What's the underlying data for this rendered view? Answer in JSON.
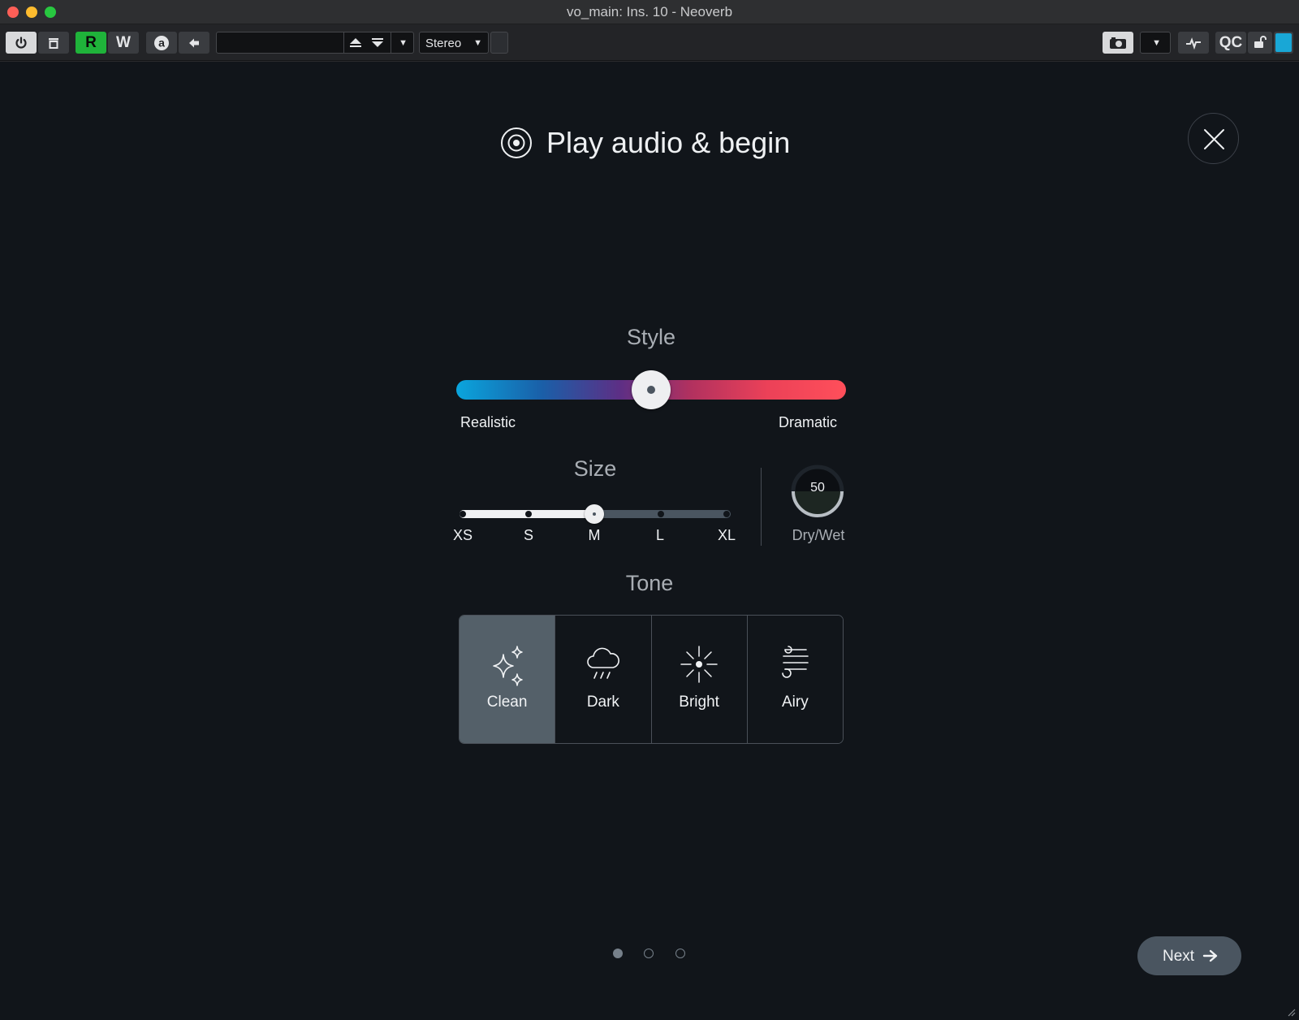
{
  "window": {
    "title": "vo_main: Ins. 10 - Neoverb"
  },
  "toolbar": {
    "power_icon": "power-icon",
    "bypass_icon": "bypass-icon",
    "read_label": "R",
    "write_label": "W",
    "automation_icon": "automation-a-icon",
    "back_icon": "arrow-left-icon",
    "preset_value": "",
    "prev_icon": "arrow-up-icon",
    "next_icon": "arrow-down-icon",
    "channel_value": "Stereo",
    "snapshot_icon": "camera-icon",
    "activity_icon": "pulse-icon",
    "qc_label": "QC",
    "lock_icon": "unlock-icon",
    "accent_color": "#19a7d6"
  },
  "assistant": {
    "heading": "Play audio & begin",
    "heading_icon": "record-target-icon",
    "close_icon": "close-icon",
    "style": {
      "label": "Style",
      "left_label": "Realistic",
      "right_label": "Dramatic",
      "value": 0.5
    },
    "size": {
      "label": "Size",
      "options": [
        "XS",
        "S",
        "M",
        "L",
        "XL"
      ],
      "selected": "M"
    },
    "dry_wet": {
      "label": "Dry/Wet",
      "value": "50"
    },
    "tone": {
      "label": "Tone",
      "options": [
        {
          "label": "Clean",
          "icon": "sparkles-icon"
        },
        {
          "label": "Dark",
          "icon": "rain-cloud-icon"
        },
        {
          "label": "Bright",
          "icon": "sun-burst-icon"
        },
        {
          "label": "Airy",
          "icon": "wind-icon"
        }
      ],
      "selected": "Clean"
    },
    "pager": {
      "total": 3,
      "current": 1
    },
    "next_label": "Next"
  }
}
